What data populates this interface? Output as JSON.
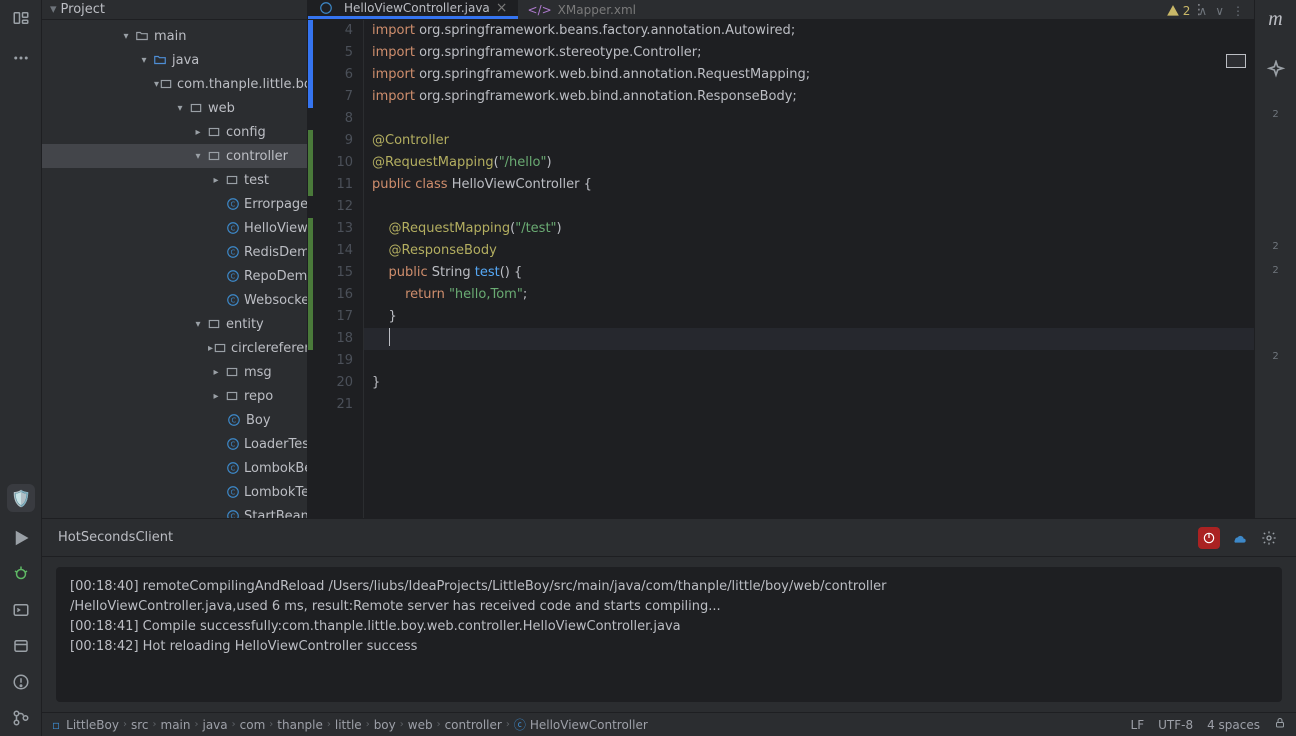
{
  "sidebar_header": "Project",
  "tree": {
    "main": "main",
    "java": "java",
    "pkg": "com.thanple.little.boy",
    "web": "web",
    "config": "config",
    "controller": "controller",
    "test": "test",
    "errorpage": "ErrorpageCont…",
    "helloview": "HelloViewCont…",
    "redis": "RedisDemoCon…",
    "repo": "RepoDemoCon…",
    "websocket": "WebsocketCor…",
    "entity": "entity",
    "circleref": "circlereference",
    "msg": "msg",
    "repo2": "repo",
    "boy": "Boy",
    "loadertest": "LoaderTest",
    "lombokbean": "LombokBean",
    "lomboktest": "LombokTest",
    "startbean": "StartBean"
  },
  "tabs": {
    "active": "HelloViewController.java",
    "other": "XMapper.xml"
  },
  "warnings": "2",
  "code": {
    "l4_a": "import",
    "l4_b": "org.springframework.beans.factory.annotation.",
    "l4_c": "Autowired",
    "l4_d": ";",
    "l5_a": "import",
    "l5_b": "org.springframework.stereotype.",
    "l5_c": "Controller",
    "l5_d": ";",
    "l6_a": "import",
    "l6_b": "org.springframework.web.bind.annotation.",
    "l6_c": "RequestMapping",
    "l6_d": ";",
    "l7_a": "import",
    "l7_b": "org.springframework.web.bind.annotation.",
    "l7_c": "ResponseBody",
    "l7_d": ";",
    "l9": "@Controller",
    "l10a": "@RequestMapping",
    "l10b": "(",
    "l10c": "\"/hello\"",
    "l10d": ")",
    "l11a": "public",
    "l11b": "class",
    "l11c": "HelloViewController {",
    "l13a": "@RequestMapping",
    "l13b": "(",
    "l13c": "\"/test\"",
    "l13d": ")",
    "l14": "@ResponseBody",
    "l15a": "public",
    "l15b": "String",
    "l15c": "test",
    "l15d": "() {",
    "l16a": "return",
    "l16b": "\"hello,Tom\"",
    "l16c": ";",
    "l17": "}",
    "l20": "}"
  },
  "gutter": [
    "4",
    "5",
    "6",
    "7",
    "8",
    "9",
    "10",
    "11",
    "12",
    "13",
    "14",
    "15",
    "16",
    "17",
    "18",
    "19",
    "20",
    "21"
  ],
  "bottom_panel_title": "HotSecondsClient",
  "console_lines": {
    "l1": "[00:18:40] remoteCompilingAndReload /Users/liubs/IdeaProjects/LittleBoy/src/main/java/com/thanple/little/boy/web/controller",
    "l2": "  /HelloViewController.java,used 6 ms, result:Remote server has received code and starts compiling...",
    "l3": "[00:18:41] Compile successfully:com.thanple.little.boy.web.controller.HelloViewController.java",
    "l4": "[00:18:42] Hot reloading HelloViewController success"
  },
  "breadcrumb": [
    "LittleBoy",
    "src",
    "main",
    "java",
    "com",
    "thanple",
    "little",
    "boy",
    "web",
    "controller",
    "HelloViewController"
  ],
  "status": {
    "le": "LF",
    "enc": "UTF-8",
    "indent": "4 spaces"
  },
  "far_right_m": "m",
  "far_right_tags": [
    "2",
    "2",
    "2",
    "2"
  ]
}
